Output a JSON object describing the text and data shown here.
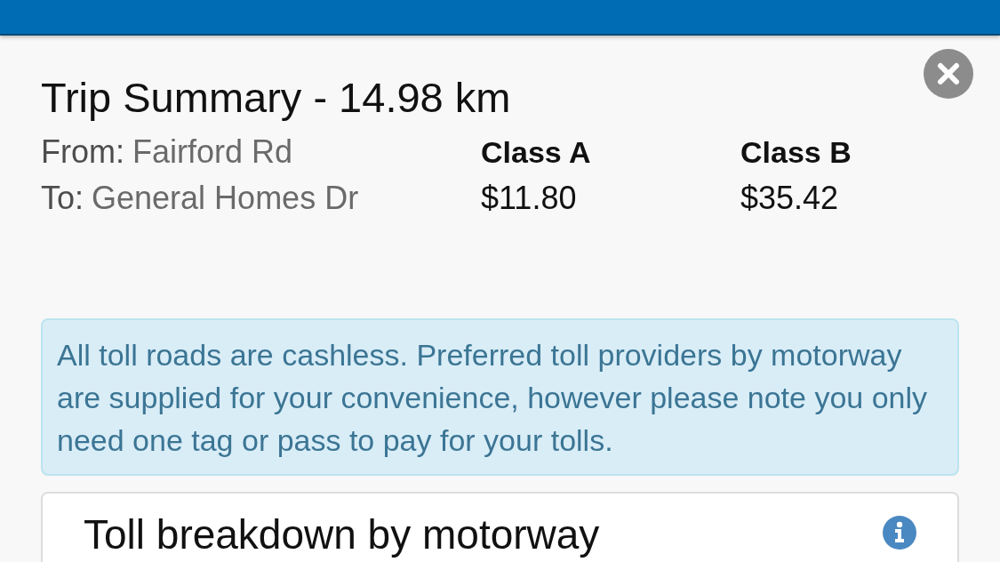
{
  "dialog": {
    "title": "Trip Summary - 14.98 km",
    "route": [
      {
        "label": "From:",
        "value": "Fairford Rd"
      },
      {
        "label": "To:",
        "value": "General Homes Dr"
      }
    ],
    "classes": [
      {
        "name": "Class A",
        "price": "$11.80"
      },
      {
        "name": "Class B",
        "price": "$35.42"
      }
    ]
  },
  "notice": "All toll roads are cashless. Preferred toll providers by motorway are supplied for your convenience, however please note you only need one tag or pass to pay for your tolls.",
  "breakdown": {
    "title": "Toll breakdown by motorway"
  }
}
